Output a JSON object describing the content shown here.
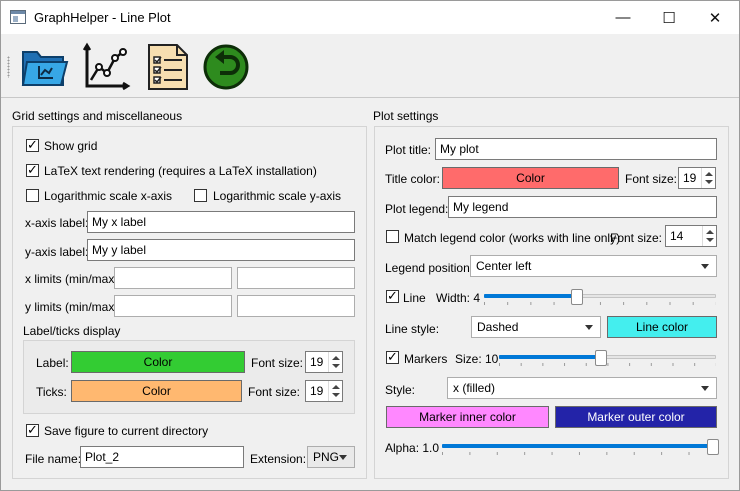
{
  "window": {
    "title": "GraphHelper - Line Plot",
    "controls": {
      "minimize": "—",
      "maximize": "☐",
      "close": "✕"
    }
  },
  "toolbar": {
    "items": [
      {
        "name": "open-folder-icon"
      },
      {
        "name": "line-plot-icon"
      },
      {
        "name": "checklist-icon"
      },
      {
        "name": "back-arrow-icon"
      }
    ]
  },
  "grid_settings": {
    "title": "Grid settings and miscellaneous",
    "show_grid": {
      "label": "Show grid",
      "checked": true
    },
    "latex": {
      "label": "LaTeX text rendering (requires a LaTeX installation)",
      "checked": true
    },
    "log_x": {
      "label": "Logarithmic scale x-axis",
      "checked": false
    },
    "log_y": {
      "label": "Logarithmic scale y-axis",
      "checked": false
    },
    "x_axis_label": {
      "label": "x-axis label:",
      "value": "My x label"
    },
    "y_axis_label": {
      "label": "y-axis label:",
      "value": "My y label"
    },
    "x_limits": {
      "label": "x limits (min/max)",
      "min": "",
      "max": ""
    },
    "y_limits": {
      "label": "y limits (min/max)",
      "min": "",
      "max": ""
    },
    "label_ticks": {
      "title": "Label/ticks display",
      "label_row": {
        "label": "Label:",
        "button": "Color",
        "color": "#33cc33",
        "font_size_label": "Font size:",
        "font_size": "19"
      },
      "ticks_row": {
        "label": "Ticks:",
        "button": "Color",
        "color": "#ffb870",
        "font_size_label": "Font size:",
        "font_size": "19"
      }
    },
    "save_figure": {
      "label": "Save figure to current directory",
      "checked": true
    },
    "file_name": {
      "label": "File name:",
      "value": "Plot_2"
    },
    "extension": {
      "label": "Extension:",
      "value": "PNG"
    }
  },
  "plot_settings": {
    "title": "Plot settings",
    "plot_title": {
      "label": "Plot title:",
      "value": "My plot"
    },
    "title_color": {
      "label": "Title color:",
      "button": "Color",
      "color": "#ff6b6b",
      "font_size_label": "Font size:",
      "font_size": "19"
    },
    "plot_legend": {
      "label": "Plot legend:",
      "value": "My legend"
    },
    "match_legend": {
      "label": "Match legend color (works with line only)",
      "checked": false,
      "font_size_label": "Font size:",
      "font_size": "14"
    },
    "legend_position": {
      "label": "Legend position:",
      "value": "Center left"
    },
    "line": {
      "label": "Line",
      "checked": true,
      "width_label": "Width: 4",
      "width_level": 0.4
    },
    "line_style": {
      "label": "Line style:",
      "value": "Dashed",
      "button": "Line color",
      "color": "#44eeee"
    },
    "markers": {
      "label": "Markers",
      "checked": true,
      "size_label": "Size: 10",
      "size_level": 0.47
    },
    "style": {
      "label": "Style:",
      "value": "x (filled)"
    },
    "marker_inner": {
      "button": "Marker inner color",
      "color": "#ff88ff"
    },
    "marker_outer": {
      "button": "Marker outer color",
      "color": "#2323a8"
    },
    "alpha": {
      "label": "Alpha: 1.0",
      "level": 1.0
    }
  }
}
